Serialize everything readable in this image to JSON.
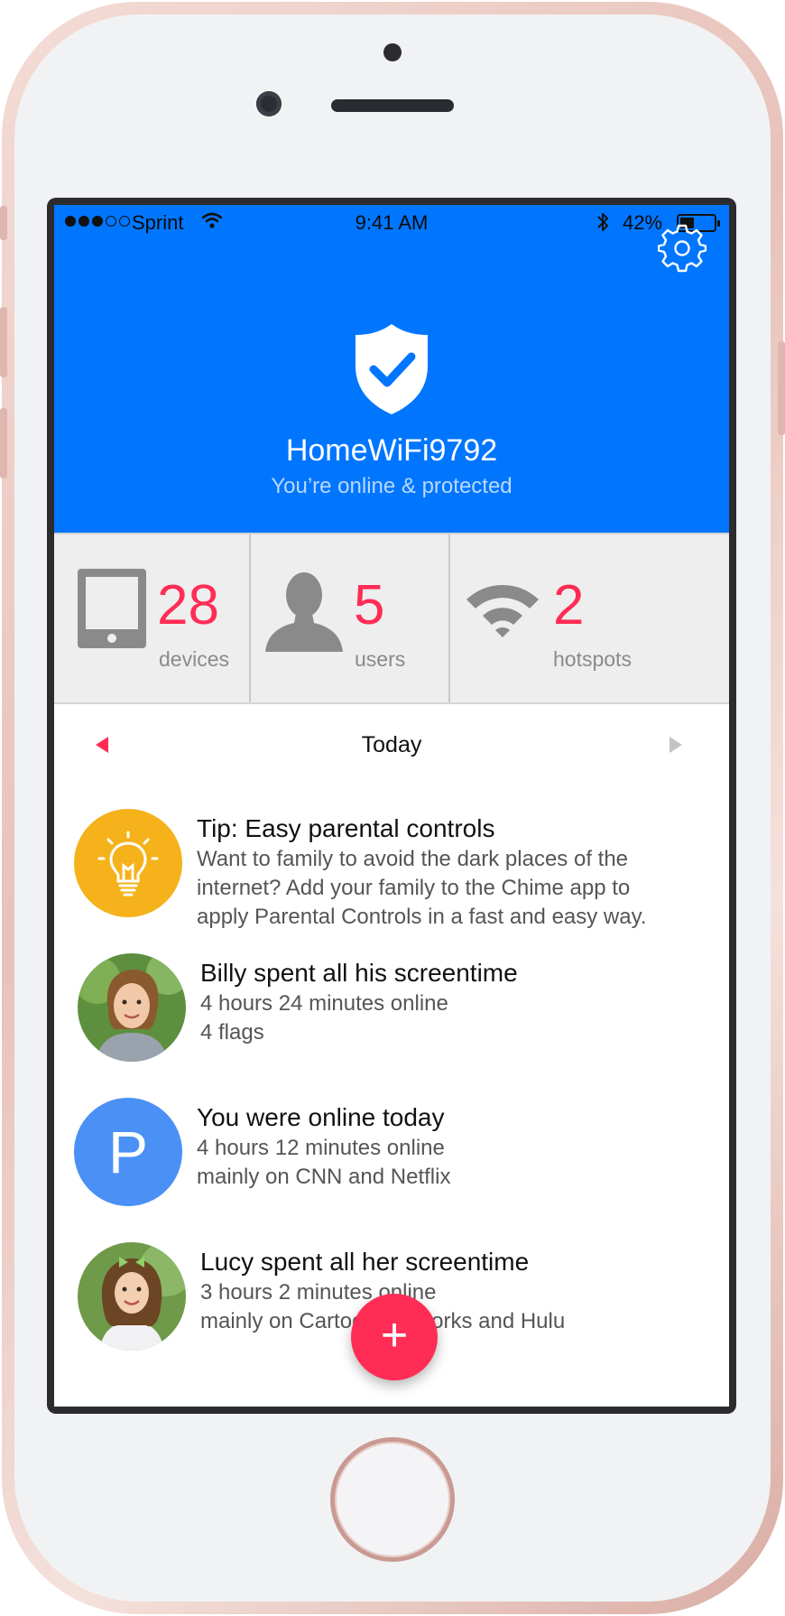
{
  "status_bar": {
    "carrier": "Sprint",
    "time": "9:41 AM",
    "battery": "42%",
    "battery_level": 0.42,
    "signal_bars_filled": 3,
    "signal_bars_total": 5
  },
  "header": {
    "network_name": "HomeWiFi9792",
    "status": "You’re online & protected",
    "background_color": "#0076ff",
    "settings_icon": "gear-icon",
    "shield_icon": "shield-check-icon"
  },
  "stats": [
    {
      "value": "28",
      "label": "devices",
      "icon": "tablet-icon"
    },
    {
      "value": "5",
      "label": "users",
      "icon": "person-icon"
    },
    {
      "value": "2",
      "label": "hotspots",
      "icon": "wifi-icon"
    }
  ],
  "date_nav": {
    "label": "Today",
    "prev_icon": "triangle-left-icon",
    "next_icon": "triangle-right-icon"
  },
  "feed": [
    {
      "title": "Tip: Easy parental controls",
      "lines": [
        "Want to family to avoid the dark places of the",
        "internet? Add your family to the Chime app to",
        "apply Parental Controls in a fast and easy way."
      ],
      "avatar": "lightbulb-icon",
      "avatar_color": "#f5b21b"
    },
    {
      "title": "Billy spent all his screentime",
      "lines": [
        "4 hours 24 minutes online",
        "4 flags"
      ],
      "avatar": "child-photo"
    },
    {
      "title": "You were online today",
      "lines": [
        "4 hours 12 minutes online",
        "mainly on CNN and Netflix"
      ],
      "avatar_letter": "P",
      "avatar_color": "#4a90f5"
    },
    {
      "title": "Lucy spent all her screentime",
      "lines": [
        "3 hours 2 minutes online",
        "mainly on Cartoon Networks and Hulu"
      ],
      "avatar": "child-photo"
    }
  ],
  "fab": {
    "label": "+",
    "color": "#ff2d55"
  }
}
